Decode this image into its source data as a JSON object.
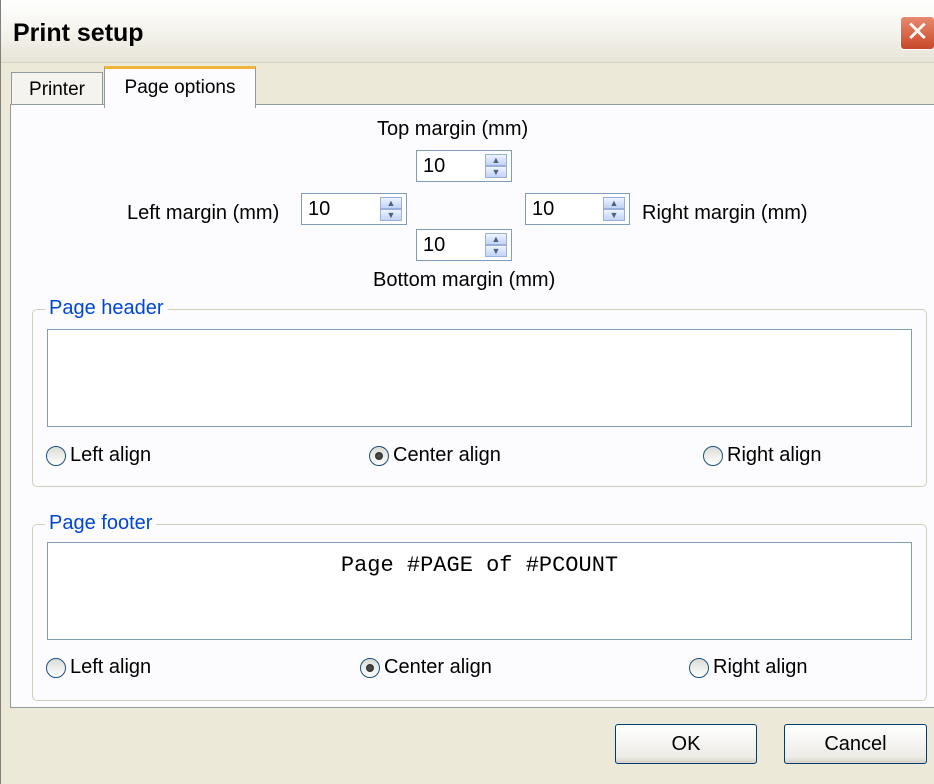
{
  "window": {
    "title": "Print setup",
    "close_glyph": "✕"
  },
  "tabs": [
    {
      "label": "Printer",
      "active": false
    },
    {
      "label": "Page options",
      "active": true
    }
  ],
  "margins": {
    "top": {
      "label": "Top margin (mm)",
      "value": "10"
    },
    "left": {
      "label": "Left margin (mm)",
      "value": "10"
    },
    "right": {
      "label": "Right margin (mm)",
      "value": "10"
    },
    "bottom": {
      "label": "Bottom margin (mm)",
      "value": "10"
    }
  },
  "header": {
    "legend": "Page header",
    "text": "",
    "left_label": "Left align",
    "center_label": "Center align",
    "right_label": "Right align",
    "selected": "center"
  },
  "footer": {
    "legend": "Page footer",
    "text": "Page #PAGE of #PCOUNT",
    "left_label": "Left align",
    "center_label": "Center align",
    "right_label": "Right align",
    "selected": "center"
  },
  "buttons": {
    "ok": "OK",
    "cancel": "Cancel"
  },
  "colors": {
    "legend": "#0046d5",
    "close": "#c8482a",
    "tab_highlight": "#f0b33c"
  }
}
